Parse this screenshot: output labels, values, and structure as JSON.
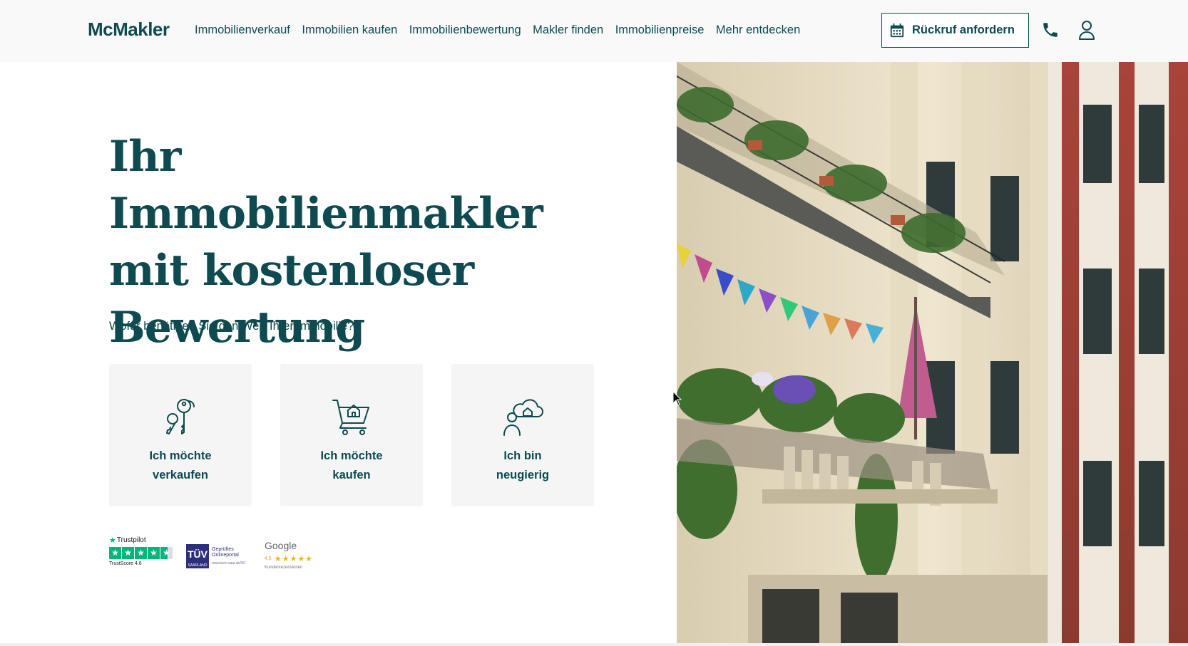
{
  "header": {
    "logo": "McMakler",
    "nav": [
      {
        "label": "Immobilienverkauf"
      },
      {
        "label": "Immobilien kaufen"
      },
      {
        "label": "Immobilienbewertung"
      },
      {
        "label": "Makler finden"
      },
      {
        "label": "Immobilienpreise"
      },
      {
        "label": "Mehr entdecken"
      }
    ],
    "callback_label": "Rückruf anfordern",
    "icons": {
      "callback": "calendar-icon",
      "phone": "phone-icon",
      "account": "user-icon"
    }
  },
  "hero": {
    "title_lines": [
      "Ihr Immobilienmakler",
      "mit kostenloser",
      "Bewertung"
    ],
    "question": "Wofür benötigen Sie den Wert Ihrer Immobilie?",
    "options": [
      {
        "line1": "Ich möchte",
        "line2": "verkaufen",
        "icon": "keys-icon"
      },
      {
        "line1": "Ich möchte",
        "line2": "kaufen",
        "icon": "shopping-cart-house-icon"
      },
      {
        "line1": "Ich bin",
        "line2": "neugierig",
        "icon": "person-cloud-house-icon"
      }
    ],
    "image": "building-balconies-photo"
  },
  "trust": {
    "trustpilot": {
      "brand": "Trustpilot",
      "score_text": "TrustScore 4.6",
      "rating": 4.6
    },
    "tuv": {
      "logo_main": "TÜV",
      "logo_sub": "SAARLAND",
      "line1": "Geprüftes",
      "line2": "Onlineportal",
      "sub": "www.tuev-saar.de/SC"
    },
    "google": {
      "brand": "Google",
      "rating_text": "4.5",
      "rating": 4.5,
      "sub": "Kundenrezensionen"
    }
  },
  "colors": {
    "primary": "#0e4a4f",
    "header_bg": "#f9f9f9",
    "card_bg": "#f5f5f5",
    "trustpilot_green": "#00b67a",
    "tuv_blue": "#2b2f7c",
    "google_star": "#f4b400"
  }
}
